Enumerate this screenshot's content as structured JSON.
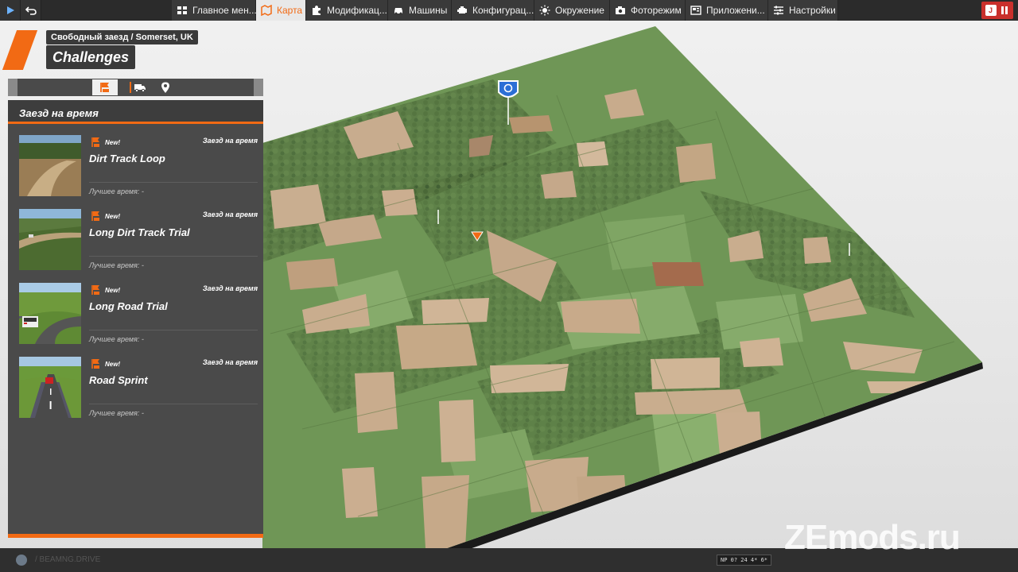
{
  "topbar": {
    "menu": [
      {
        "label": "Главное мен...",
        "icon": "home-icon",
        "active": false
      },
      {
        "label": "Карта",
        "icon": "map-icon",
        "active": true
      },
      {
        "label": "Модификац...",
        "icon": "puzzle-icon",
        "active": false
      },
      {
        "label": "Машины",
        "icon": "car-icon",
        "active": false
      },
      {
        "label": "Конфигурац...",
        "icon": "engine-icon",
        "active": false
      },
      {
        "label": "Окружение",
        "icon": "sun-icon",
        "active": false
      },
      {
        "label": "Фоторежим",
        "icon": "camera-icon",
        "active": false
      },
      {
        "label": "Приложени...",
        "icon": "apps-icon",
        "active": false
      },
      {
        "label": "Настройки",
        "icon": "sliders-icon",
        "active": false
      }
    ],
    "right_badge": "J"
  },
  "header": {
    "breadcrumb": "Свободный заезд / Somerset, UK",
    "title": "Challenges"
  },
  "filter_tabs": [
    "flag-icon",
    "truck-icon",
    "pin-icon"
  ],
  "panel": {
    "section_title": "Заезд на время",
    "challenges": [
      {
        "name": "Dirt Track Loop",
        "new": "New!",
        "type": "Заезд на время",
        "best": "Лучшее время: -",
        "thumb": "dirt"
      },
      {
        "name": "Long Dirt Track Trial",
        "new": "New!",
        "type": "Заезд на время",
        "best": "Лучшее время: -",
        "thumb": "hill"
      },
      {
        "name": "Long Road Trial",
        "new": "New!",
        "type": "Заезд на время",
        "best": "Лучшее время: -",
        "thumb": "road"
      },
      {
        "name": "Road Sprint",
        "new": "New!",
        "type": "Заезд на время",
        "best": "Лучшее время: -",
        "thumb": "sprint"
      }
    ]
  },
  "colors": {
    "accent": "#f26a14",
    "panel": "#4a4a4a",
    "topbar": "#2b2b2b"
  },
  "bottombar": {
    "text": "/ BEAMNG.DRIVE",
    "build": "NP 0? 24 4* 6*"
  },
  "watermark": "ZEmods.ru"
}
